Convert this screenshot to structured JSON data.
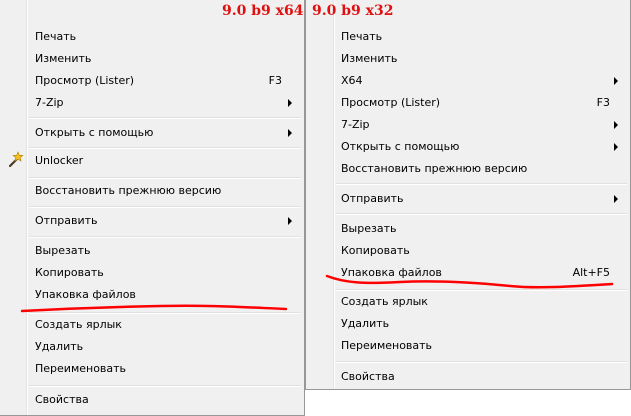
{
  "labels": {
    "left_title": "9.0 b9 x64",
    "right_title": "9.0 b9 x32"
  },
  "left_menu": {
    "cut_off_top": "______ ______",
    "items": [
      {
        "label": "Печать"
      },
      {
        "label": "Изменить"
      },
      {
        "label": "Просмотр (Lister)",
        "shortcut": "F3"
      },
      {
        "label": "7-Zip",
        "submenu": true
      },
      {
        "label": "Открыть с помощью",
        "submenu": true
      },
      {
        "label": "Unlocker",
        "icon": "magic-wand-icon"
      },
      {
        "label": "Восстановить прежнюю версию"
      },
      {
        "label": "Отправить",
        "submenu": true
      },
      {
        "label": "Вырезать"
      },
      {
        "label": "Копировать"
      },
      {
        "label": "Упаковка файлов"
      },
      {
        "label": "Создать ярлык"
      },
      {
        "label": "Удалить"
      },
      {
        "label": "Переименовать"
      },
      {
        "label": "Свойства"
      }
    ]
  },
  "right_menu": {
    "cut_off_top": "______ ______",
    "items": [
      {
        "label": "Печать"
      },
      {
        "label": "Изменить"
      },
      {
        "label": "X64",
        "submenu": true
      },
      {
        "label": "Просмотр (Lister)",
        "shortcut": "F3"
      },
      {
        "label": "7-Zip",
        "submenu": true
      },
      {
        "label": "Открыть с помощью",
        "submenu": true
      },
      {
        "label": "Восстановить прежнюю версию"
      },
      {
        "label": "Отправить",
        "submenu": true
      },
      {
        "label": "Вырезать"
      },
      {
        "label": "Копировать"
      },
      {
        "label": "Упаковка файлов",
        "shortcut": "Alt+F5"
      },
      {
        "label": "Создать ярлык"
      },
      {
        "label": "Удалить"
      },
      {
        "label": "Переименовать"
      },
      {
        "label": "Свойства"
      }
    ]
  },
  "colors": {
    "annotation": "#ff0000",
    "menu_background": "#f0f0f0"
  }
}
